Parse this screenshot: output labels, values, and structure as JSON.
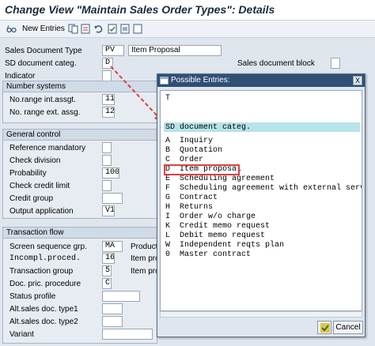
{
  "window": {
    "title": "Change View \"Maintain Sales Order Types\": Details"
  },
  "toolbar": {
    "new_entries": "New Entries"
  },
  "colors": {
    "accent": "#2f4f74",
    "highlight": "#b7e3ea",
    "selection_border": "#e04040",
    "arrow": "#e04040"
  },
  "header_fields": {
    "sales_document_type": {
      "label": "Sales Document Type",
      "code": "PV",
      "description": "Item Proposal"
    },
    "sd_document_categ": {
      "label": "SD document categ.",
      "value": "D"
    },
    "sales_document_block": {
      "label": "Sales document block"
    },
    "indicator": {
      "label": "Indicator"
    }
  },
  "number_systems": {
    "title": "Number systems",
    "no_range_int": {
      "label": "No.range int.assgt.",
      "value": "11"
    },
    "no_range_ext": {
      "label": "No. range ext. assg.",
      "value": "12"
    }
  },
  "general_control": {
    "title": "General control",
    "reference_mandatory": {
      "label": "Reference mandatory"
    },
    "check_division": {
      "label": "Check division"
    },
    "probability": {
      "label": "Probability",
      "value": "100"
    },
    "check_credit_limit": {
      "label": "Check credit limit"
    },
    "credit_group": {
      "label": "Credit group"
    },
    "output_application": {
      "label": "Output application",
      "value": "V1"
    }
  },
  "transaction_flow": {
    "title": "Transaction flow",
    "screen_sequence": {
      "label": "Screen sequence grp.",
      "value": "MA"
    },
    "incompl_proced": {
      "label": "Incompl.proced.",
      "value": "16"
    },
    "transaction_group": {
      "label": "Transaction group",
      "value": "5"
    },
    "doc_pric_procedure": {
      "label": "Doc. pric. procedure",
      "value": "C"
    },
    "status_profile": {
      "label": "Status profile"
    },
    "alt_sales_doc_type1": {
      "label": "Alt.sales doc. type1"
    },
    "alt_sales_doc_type2": {
      "label": "Alt.sales doc. type2"
    },
    "variant": {
      "label": "Variant"
    },
    "product_partial": "Product",
    "item_partial_1": "Item pro",
    "item_partial_2": "Item pro"
  },
  "popup": {
    "title": "Possible Entries:",
    "close_symbol": "X",
    "filter_letter": "T",
    "column_header": "SD document categ.",
    "entries": [
      {
        "code": "A",
        "text": "Inquiry"
      },
      {
        "code": "B",
        "text": "Quotation"
      },
      {
        "code": "C",
        "text": "Order"
      },
      {
        "code": "D",
        "text": "Item proposal"
      },
      {
        "code": "E",
        "text": "Scheduling agreement"
      },
      {
        "code": "F",
        "text": "Scheduling agreement with external servic"
      },
      {
        "code": "G",
        "text": "Contract"
      },
      {
        "code": "H",
        "text": "Returns"
      },
      {
        "code": "I",
        "text": "Order w/o charge"
      },
      {
        "code": "K",
        "text": "Credit memo request"
      },
      {
        "code": "L",
        "text": "Debit memo request"
      },
      {
        "code": "W",
        "text": "Independent reqts plan"
      },
      {
        "code": "0",
        "text": "Master contract"
      }
    ],
    "selected_code": "D",
    "ok_label": "",
    "cancel_label": "Cancel"
  }
}
